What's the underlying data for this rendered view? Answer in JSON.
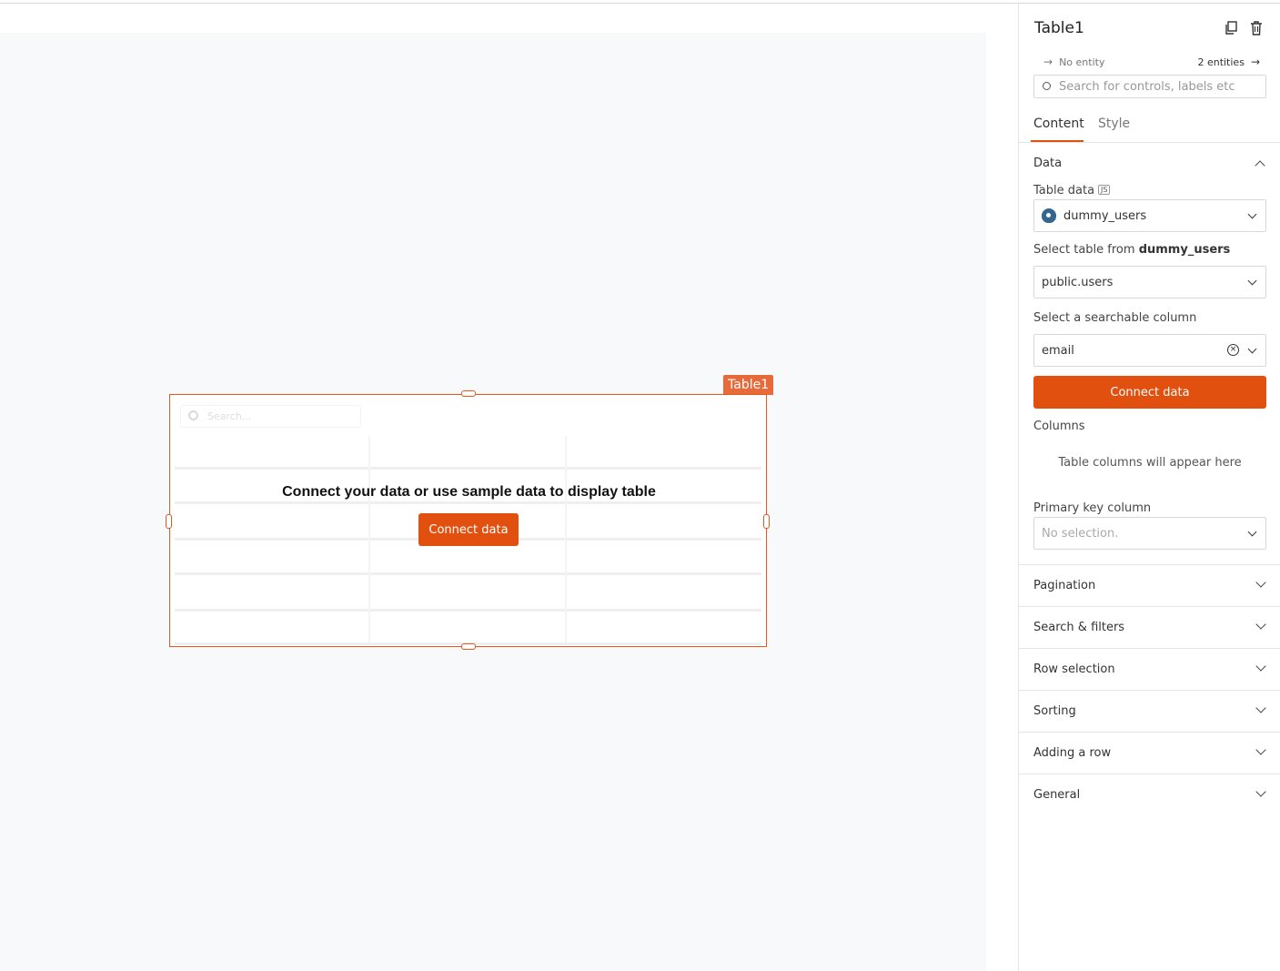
{
  "canvas": {
    "widget_tag": "Table1",
    "table": {
      "search_placeholder": "Search...",
      "message": "Connect your data or use sample data to display table",
      "connect_button": "Connect data"
    }
  },
  "panel": {
    "title": "Table1",
    "icons": [
      "copy-icon",
      "trash-icon"
    ],
    "entities": {
      "left": "No entity",
      "right": "2 entities"
    },
    "search_placeholder": "Search for controls, labels etc",
    "tabs": [
      {
        "label": "Content",
        "active": true
      },
      {
        "label": "Style",
        "active": false
      }
    ],
    "data_section": {
      "title": "Data",
      "table_data_label": "Table data",
      "js_badge": "JS",
      "datasource": "dummy_users",
      "select_table_label": "Select table from",
      "select_table_source": "dummy_users",
      "table_value": "public.users",
      "searchable_label": "Select a searchable column",
      "searchable_value": "email",
      "connect_button": "Connect data",
      "columns_label": "Columns",
      "columns_empty": "Table columns will appear here",
      "primary_key_label": "Primary key column",
      "primary_key_placeholder": "No selection."
    },
    "sections": [
      "Pagination",
      "Search & filters",
      "Row selection",
      "Sorting",
      "Adding a row",
      "General"
    ]
  },
  "colors": {
    "accent": "#e25010",
    "canvas_bg": "#f8f9fa",
    "border": "#e5e5e5"
  }
}
